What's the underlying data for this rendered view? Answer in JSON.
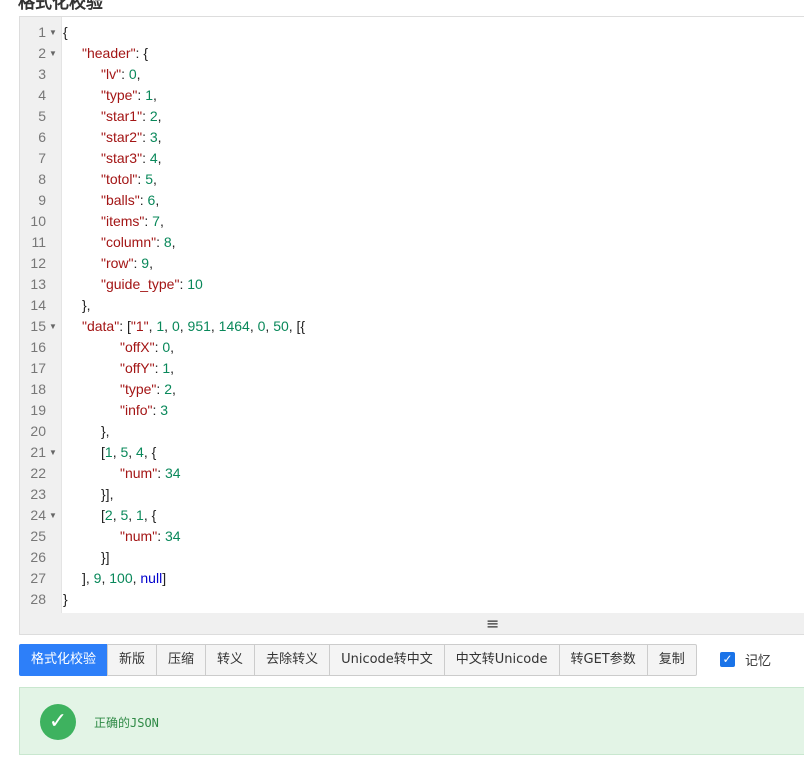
{
  "page_title": "格式化校验",
  "editor": {
    "lines": [
      {
        "num": "1",
        "fold": true,
        "indent": 0,
        "parts": [
          {
            "t": "p",
            "v": "{"
          }
        ]
      },
      {
        "num": "2",
        "fold": true,
        "indent": 1,
        "parts": [
          {
            "t": "k",
            "v": "\"header\""
          },
          {
            "t": "p",
            "v": ": {"
          }
        ]
      },
      {
        "num": "3",
        "fold": false,
        "indent": 2,
        "parts": [
          {
            "t": "k",
            "v": "\"lv\""
          },
          {
            "t": "p",
            "v": ": "
          },
          {
            "t": "n",
            "v": "0"
          },
          {
            "t": "p",
            "v": ","
          }
        ]
      },
      {
        "num": "4",
        "fold": false,
        "indent": 2,
        "parts": [
          {
            "t": "k",
            "v": "\"type\""
          },
          {
            "t": "p",
            "v": ": "
          },
          {
            "t": "n",
            "v": "1"
          },
          {
            "t": "p",
            "v": ","
          }
        ]
      },
      {
        "num": "5",
        "fold": false,
        "indent": 2,
        "parts": [
          {
            "t": "k",
            "v": "\"star1\""
          },
          {
            "t": "p",
            "v": ": "
          },
          {
            "t": "n",
            "v": "2"
          },
          {
            "t": "p",
            "v": ","
          }
        ]
      },
      {
        "num": "6",
        "fold": false,
        "indent": 2,
        "parts": [
          {
            "t": "k",
            "v": "\"star2\""
          },
          {
            "t": "p",
            "v": ": "
          },
          {
            "t": "n",
            "v": "3"
          },
          {
            "t": "p",
            "v": ","
          }
        ]
      },
      {
        "num": "7",
        "fold": false,
        "indent": 2,
        "parts": [
          {
            "t": "k",
            "v": "\"star3\""
          },
          {
            "t": "p",
            "v": ": "
          },
          {
            "t": "n",
            "v": "4"
          },
          {
            "t": "p",
            "v": ","
          }
        ]
      },
      {
        "num": "8",
        "fold": false,
        "indent": 2,
        "parts": [
          {
            "t": "k",
            "v": "\"totol\""
          },
          {
            "t": "p",
            "v": ": "
          },
          {
            "t": "n",
            "v": "5"
          },
          {
            "t": "p",
            "v": ","
          }
        ]
      },
      {
        "num": "9",
        "fold": false,
        "indent": 2,
        "parts": [
          {
            "t": "k",
            "v": "\"balls\""
          },
          {
            "t": "p",
            "v": ": "
          },
          {
            "t": "n",
            "v": "6"
          },
          {
            "t": "p",
            "v": ","
          }
        ]
      },
      {
        "num": "10",
        "fold": false,
        "indent": 2,
        "parts": [
          {
            "t": "k",
            "v": "\"items\""
          },
          {
            "t": "p",
            "v": ": "
          },
          {
            "t": "n",
            "v": "7"
          },
          {
            "t": "p",
            "v": ","
          }
        ]
      },
      {
        "num": "11",
        "fold": false,
        "indent": 2,
        "parts": [
          {
            "t": "k",
            "v": "\"column\""
          },
          {
            "t": "p",
            "v": ": "
          },
          {
            "t": "n",
            "v": "8"
          },
          {
            "t": "p",
            "v": ","
          }
        ]
      },
      {
        "num": "12",
        "fold": false,
        "indent": 2,
        "parts": [
          {
            "t": "k",
            "v": "\"row\""
          },
          {
            "t": "p",
            "v": ": "
          },
          {
            "t": "n",
            "v": "9"
          },
          {
            "t": "p",
            "v": ","
          }
        ]
      },
      {
        "num": "13",
        "fold": false,
        "indent": 2,
        "parts": [
          {
            "t": "k",
            "v": "\"guide_type\""
          },
          {
            "t": "p",
            "v": ": "
          },
          {
            "t": "n",
            "v": "10"
          }
        ]
      },
      {
        "num": "14",
        "fold": false,
        "indent": 1,
        "parts": [
          {
            "t": "p",
            "v": "},"
          }
        ]
      },
      {
        "num": "15",
        "fold": true,
        "indent": 1,
        "parts": [
          {
            "t": "k",
            "v": "\"data\""
          },
          {
            "t": "p",
            "v": ": ["
          },
          {
            "t": "k",
            "v": "\"1\""
          },
          {
            "t": "p",
            "v": ", "
          },
          {
            "t": "n",
            "v": "1"
          },
          {
            "t": "p",
            "v": ", "
          },
          {
            "t": "n",
            "v": "0"
          },
          {
            "t": "p",
            "v": ", "
          },
          {
            "t": "n",
            "v": "951"
          },
          {
            "t": "p",
            "v": ", "
          },
          {
            "t": "n",
            "v": "1464"
          },
          {
            "t": "p",
            "v": ", "
          },
          {
            "t": "n",
            "v": "0"
          },
          {
            "t": "p",
            "v": ", "
          },
          {
            "t": "n",
            "v": "50"
          },
          {
            "t": "p",
            "v": ", [{"
          }
        ]
      },
      {
        "num": "16",
        "fold": false,
        "indent": 3,
        "parts": [
          {
            "t": "k",
            "v": "\"offX\""
          },
          {
            "t": "p",
            "v": ": "
          },
          {
            "t": "n",
            "v": "0"
          },
          {
            "t": "p",
            "v": ","
          }
        ]
      },
      {
        "num": "17",
        "fold": false,
        "indent": 3,
        "parts": [
          {
            "t": "k",
            "v": "\"offY\""
          },
          {
            "t": "p",
            "v": ": "
          },
          {
            "t": "n",
            "v": "1"
          },
          {
            "t": "p",
            "v": ","
          }
        ]
      },
      {
        "num": "18",
        "fold": false,
        "indent": 3,
        "parts": [
          {
            "t": "k",
            "v": "\"type\""
          },
          {
            "t": "p",
            "v": ": "
          },
          {
            "t": "n",
            "v": "2"
          },
          {
            "t": "p",
            "v": ","
          }
        ]
      },
      {
        "num": "19",
        "fold": false,
        "indent": 3,
        "parts": [
          {
            "t": "k",
            "v": "\"info\""
          },
          {
            "t": "p",
            "v": ": "
          },
          {
            "t": "n",
            "v": "3"
          }
        ]
      },
      {
        "num": "20",
        "fold": false,
        "indent": 2,
        "parts": [
          {
            "t": "p",
            "v": "},"
          }
        ]
      },
      {
        "num": "21",
        "fold": true,
        "indent": 2,
        "parts": [
          {
            "t": "p",
            "v": "["
          },
          {
            "t": "n",
            "v": "1"
          },
          {
            "t": "p",
            "v": ", "
          },
          {
            "t": "n",
            "v": "5"
          },
          {
            "t": "p",
            "v": ", "
          },
          {
            "t": "n",
            "v": "4"
          },
          {
            "t": "p",
            "v": ", {"
          }
        ]
      },
      {
        "num": "22",
        "fold": false,
        "indent": 3,
        "parts": [
          {
            "t": "k",
            "v": "\"num\""
          },
          {
            "t": "p",
            "v": ": "
          },
          {
            "t": "n",
            "v": "34"
          }
        ]
      },
      {
        "num": "23",
        "fold": false,
        "indent": 2,
        "parts": [
          {
            "t": "p",
            "v": "}],"
          }
        ]
      },
      {
        "num": "24",
        "fold": true,
        "indent": 2,
        "parts": [
          {
            "t": "p",
            "v": "["
          },
          {
            "t": "n",
            "v": "2"
          },
          {
            "t": "p",
            "v": ", "
          },
          {
            "t": "n",
            "v": "5"
          },
          {
            "t": "p",
            "v": ", "
          },
          {
            "t": "n",
            "v": "1"
          },
          {
            "t": "p",
            "v": ", {"
          }
        ]
      },
      {
        "num": "25",
        "fold": false,
        "indent": 3,
        "parts": [
          {
            "t": "k",
            "v": "\"num\""
          },
          {
            "t": "p",
            "v": ": "
          },
          {
            "t": "n",
            "v": "34"
          }
        ]
      },
      {
        "num": "26",
        "fold": false,
        "indent": 2,
        "parts": [
          {
            "t": "p",
            "v": "}]"
          }
        ]
      },
      {
        "num": "27",
        "fold": false,
        "indent": 1,
        "parts": [
          {
            "t": "p",
            "v": "], "
          },
          {
            "t": "n",
            "v": "9"
          },
          {
            "t": "p",
            "v": ", "
          },
          {
            "t": "n",
            "v": "100"
          },
          {
            "t": "p",
            "v": ", "
          },
          {
            "t": "nl",
            "v": "null"
          },
          {
            "t": "p",
            "v": "]"
          }
        ]
      },
      {
        "num": "28",
        "fold": false,
        "indent": 0,
        "parts": [
          {
            "t": "p",
            "v": "}"
          }
        ]
      }
    ]
  },
  "resize_handle": "≡",
  "toolbar": {
    "buttons": [
      "格式化校验",
      "新版",
      "压缩",
      "转义",
      "去除转义",
      "Unicode转中文",
      "中文转Unicode",
      "转GET参数",
      "复制"
    ]
  },
  "remember": {
    "label": "记忆",
    "checked": true
  },
  "result": {
    "icon": "check-circle-icon",
    "text": "正确的JSON"
  }
}
